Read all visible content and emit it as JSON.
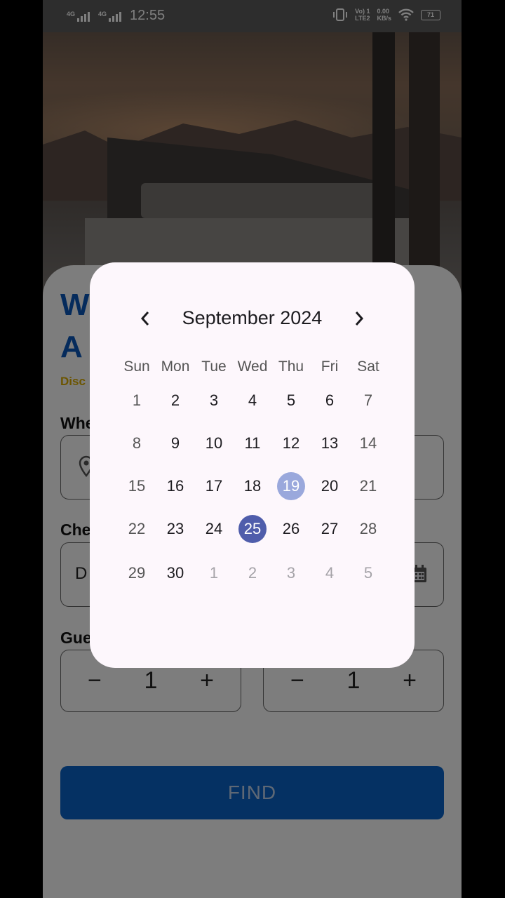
{
  "status_bar": {
    "time": "12:55",
    "net1": "4G",
    "net2": "4G",
    "volte_top": "Vo) 1",
    "volte_bottom": "LTE2",
    "speed_top": "0.00",
    "speed_bottom": "KB/s",
    "battery": "71"
  },
  "form": {
    "title_line1": "W",
    "title_line2": "A",
    "discount": "Disc",
    "where_label": "Whe",
    "checkin_label": "Che",
    "checkin_value": "D",
    "guests_label": "Gue",
    "guests": {
      "minus": "−",
      "value": "1",
      "plus": "+"
    },
    "rooms": {
      "minus": "−",
      "value": "1",
      "plus": "+"
    },
    "find_button": "FIND"
  },
  "calendar": {
    "month_label": "September 2024",
    "weekdays": [
      "Sun",
      "Mon",
      "Tue",
      "Wed",
      "Thu",
      "Fri",
      "Sat"
    ],
    "weeks": [
      [
        "1",
        "2",
        "3",
        "4",
        "5",
        "6",
        "7"
      ],
      [
        "8",
        "9",
        "10",
        "11",
        "12",
        "13",
        "14"
      ],
      [
        "15",
        "16",
        "17",
        "18",
        "19",
        "20",
        "21"
      ],
      [
        "22",
        "23",
        "24",
        "25",
        "26",
        "27",
        "28"
      ],
      [
        "29",
        "30",
        "1",
        "2",
        "3",
        "4",
        "5"
      ]
    ],
    "today": "19",
    "selected": "25",
    "today_color": "#9aa8dc",
    "selected_color": "#4f5dab"
  },
  "icons": {
    "prev": "chevron-left-icon",
    "next": "chevron-right-icon",
    "location": "location-pin-icon",
    "calendar": "calendar-icon"
  }
}
